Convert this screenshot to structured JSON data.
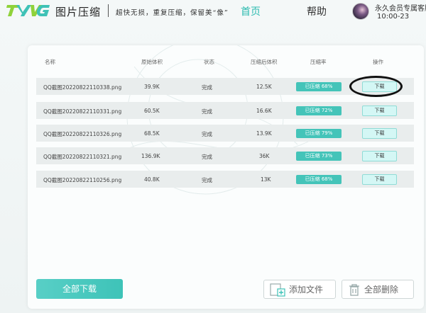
{
  "header": {
    "app_title": "图片压缩",
    "slogan": "超快无损，重复压缩，保留美“像”",
    "nav": {
      "home": "首页",
      "help": "帮助"
    },
    "user": {
      "name": "永久会员专属客服",
      "time": "10:00-23"
    }
  },
  "table": {
    "columns": [
      "名称",
      "原始体积",
      "状态",
      "压缩后体积",
      "压缩率",
      "操作"
    ],
    "rows": [
      {
        "name": "QQ截图20220822110338.png",
        "original": "39.9K",
        "status": "完成",
        "compressed": "12.5K",
        "rate": "已压缩 68%",
        "action": "下载"
      },
      {
        "name": "QQ截图20220822110331.png",
        "original": "60.5K",
        "status": "完成",
        "compressed": "16.6K",
        "rate": "已压缩 72%",
        "action": "下载"
      },
      {
        "name": "QQ截图20220822110326.png",
        "original": "68.5K",
        "status": "完成",
        "compressed": "13.9K",
        "rate": "已压缩 79%",
        "action": "下载"
      },
      {
        "name": "QQ截图20220822110321.png",
        "original": "136.9K",
        "status": "完成",
        "compressed": "36K",
        "rate": "已压缩 73%",
        "action": "下载"
      },
      {
        "name": "QQ截图20220822110256.png",
        "original": "40.8K",
        "status": "完成",
        "compressed": "13K",
        "rate": "已压缩 68%",
        "action": "下载"
      }
    ]
  },
  "footer": {
    "download_all": "全部下载",
    "add_file": "添加文件",
    "delete_all": "全部删除"
  },
  "colors": {
    "accent": "#2cbbb0",
    "badge": "#44c4b9",
    "button_light": "#d4f7f5"
  }
}
